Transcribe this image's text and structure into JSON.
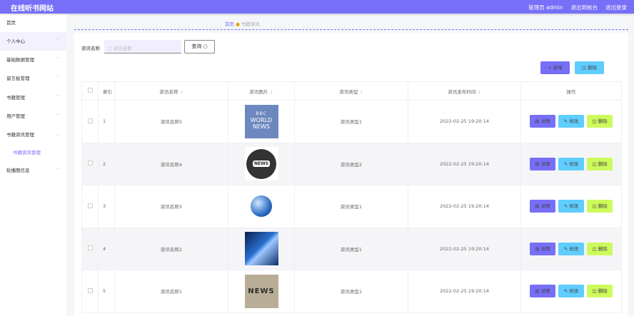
{
  "header": {
    "title": "在线听书网站",
    "user": "管理员 admin",
    "to_front": "退出到前台",
    "logout": "退出登录"
  },
  "sidebar": {
    "items": [
      {
        "label": "首页"
      },
      {
        "label": "个人中心"
      },
      {
        "label": "基础数据管理"
      },
      {
        "label": "留言板管理"
      },
      {
        "label": "书籍管理"
      },
      {
        "label": "用户管理"
      },
      {
        "label": "书籍资讯管理"
      },
      {
        "label": "书籍资讯管理"
      },
      {
        "label": "轮播图信息"
      }
    ]
  },
  "breadcrumb": {
    "home": "首页",
    "current": "书籍资讯"
  },
  "search": {
    "label": "资讯名称",
    "placeholder": "资讯名称",
    "button": "查询"
  },
  "actions": {
    "add": "新增",
    "delete": "删除"
  },
  "colors": {
    "accent": "#776ff7",
    "edit": "#5fcdfd",
    "delete": "#cdfa5c",
    "add": "#776ff7"
  },
  "table": {
    "headers": [
      "索引",
      "资讯名称",
      "资讯图片",
      "资讯类型",
      "资讯发布时间",
      "操作"
    ],
    "ops": {
      "detail": "详情",
      "edit": "修改",
      "delete": "删除"
    },
    "rows": [
      {
        "index": "1",
        "name": "资讯名称5",
        "image": "bbc-world-news",
        "type": "资讯类型1",
        "time": "2022-02-25 19:20:14"
      },
      {
        "index": "2",
        "name": "资讯名称4",
        "image": "news-globe-badge",
        "type": "资讯类型2",
        "time": "2022-02-25 19:20:14"
      },
      {
        "index": "3",
        "name": "资讯名称3",
        "image": "blue-globe",
        "type": "资讯类型1",
        "time": "2022-02-25 19:20:14"
      },
      {
        "index": "4",
        "name": "资讯名称2",
        "image": "blue-globe-abstract",
        "type": "资讯类型1",
        "time": "2022-02-25 19:20:14"
      },
      {
        "index": "5",
        "name": "资讯名称1",
        "image": "news-letters",
        "type": "资讯类型1",
        "time": "2022-02-25 19:20:14"
      }
    ]
  },
  "images": {
    "bbc": "BBC",
    "world": "WORLD",
    "news": "NEWS",
    "badge": "NEWS",
    "letters": "NEWS"
  }
}
